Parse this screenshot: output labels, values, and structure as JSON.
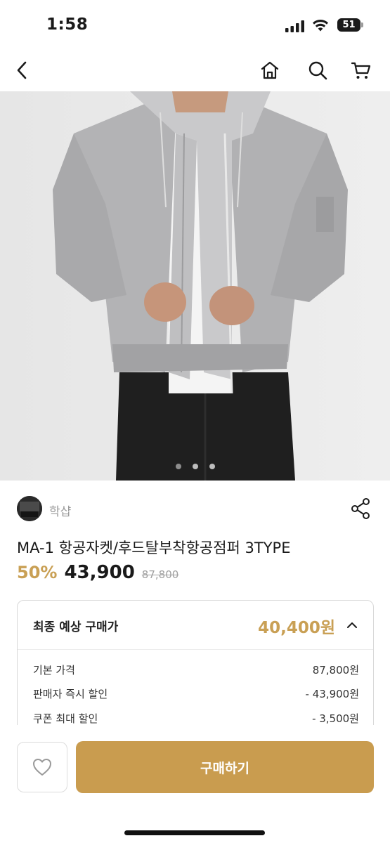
{
  "status_bar": {
    "time": "1:58",
    "battery": "51",
    "icons": [
      "cellular-signal-icon",
      "wifi-icon",
      "battery-icon"
    ]
  },
  "nav": {
    "icons": [
      "back-arrow-icon",
      "home-icon",
      "search-icon",
      "cart-icon"
    ]
  },
  "gallery": {
    "image": "product-photo-gray-hooded-ma1-jacket",
    "page_count": 3,
    "active_index": 0
  },
  "seller": {
    "name": "학샵"
  },
  "product": {
    "title": "MA-1 항공자켓/후드탈부착항공점퍼 3TYPE",
    "discount": "50%",
    "price": "43,900",
    "original_price": "87,800"
  },
  "price_breakdown": {
    "header_label": "최종 예상 구매가",
    "header_value": "40,400원",
    "items": [
      {
        "label": "기본 가격",
        "value": "87,800원"
      },
      {
        "label": "판매자 즉시 할인",
        "value": "- 43,900원"
      },
      {
        "label": "쿠폰 최대 할인",
        "value": "- 3,500원"
      }
    ]
  },
  "bottom_bar": {
    "buy_label": "구매하기"
  },
  "colors": {
    "accent": "#c9a055",
    "buy_button": "#c99c4f",
    "text": "#1a1a1a",
    "muted": "#9a9a9a"
  }
}
